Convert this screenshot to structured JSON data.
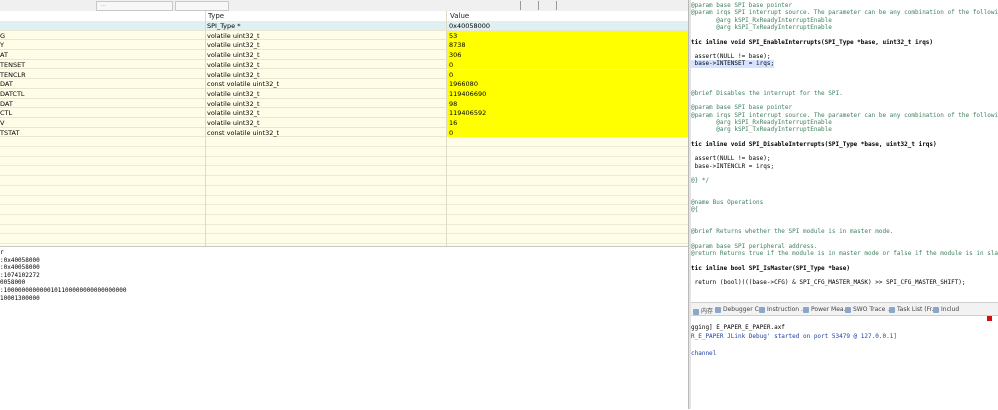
{
  "toolbar": {
    "stub_text": "...",
    "right_text": "497  /**"
  },
  "table": {
    "headers": {
      "name": "",
      "type": "Type",
      "value": "Value"
    },
    "rows": [
      {
        "name": "",
        "type": "SPI_Type *",
        "value": "0x40058000"
      },
      {
        "name": "G",
        "type": "volatile uint32_t",
        "value": "53"
      },
      {
        "name": "Y",
        "type": "volatile uint32_t",
        "value": "8738"
      },
      {
        "name": "AT",
        "type": "volatile uint32_t",
        "value": "306"
      },
      {
        "name": "TENSET",
        "type": "volatile uint32_t",
        "value": "0"
      },
      {
        "name": "TENCLR",
        "type": "volatile uint32_t",
        "value": "0"
      },
      {
        "name": "DAT",
        "type": "const volatile uint32_t",
        "value": "1966080"
      },
      {
        "name": "DATCTL",
        "type": "volatile uint32_t",
        "value": "119406690"
      },
      {
        "name": "DAT",
        "type": "volatile uint32_t",
        "value": "98"
      },
      {
        "name": "CTL",
        "type": "volatile uint32_t",
        "value": "119406592"
      },
      {
        "name": "V",
        "type": "volatile uint32_t",
        "value": "16"
      },
      {
        "name": "TSTAT",
        "type": "const volatile uint32_t",
        "value": "0"
      }
    ]
  },
  "console": {
    "lines": [
      "r",
      ":0x40058000",
      ":0x40058000",
      ":1074102272",
      "0058000",
      ":1000000000000101100000000000000000",
      "10001300000"
    ]
  },
  "editor": {
    "lines": [
      {
        "t": "@param base SPI base pointer",
        "k": "c"
      },
      {
        "t": "@param irqs SPI interrupt source. The parameter can be any combination of the following value",
        "k": "c"
      },
      {
        "t": "       @arg kSPI_RxReadyInterruptEnable",
        "k": "c"
      },
      {
        "t": "       @arg kSPI_TxReadyInterruptEnable",
        "k": "c"
      },
      {
        "t": "",
        "k": ""
      },
      {
        "t": "tic inline void SPI_EnableInterrupts(SPI_Type *base, uint32_t irqs)",
        "k": "f"
      },
      {
        "t": "",
        "k": ""
      },
      {
        "t": " assert(NULL != base);",
        "k": "n"
      },
      {
        "t": " base->INTENSET = irqs;",
        "k": "h"
      },
      {
        "t": "",
        "k": ""
      },
      {
        "t": "",
        "k": ""
      },
      {
        "t": "",
        "k": ""
      },
      {
        "t": "@brief Disables the interrupt for the SPI.",
        "k": "c"
      },
      {
        "t": "",
        "k": ""
      },
      {
        "t": "@param base SPI base pointer",
        "k": "c"
      },
      {
        "t": "@param irqs SPI interrupt source. The parameter can be any combination of the following value",
        "k": "c"
      },
      {
        "t": "       @arg kSPI_RxReadyInterruptEnable",
        "k": "c"
      },
      {
        "t": "       @arg kSPI_TxReadyInterruptEnable",
        "k": "c"
      },
      {
        "t": "",
        "k": ""
      },
      {
        "t": "tic inline void SPI_DisableInterrupts(SPI_Type *base, uint32_t irqs)",
        "k": "f"
      },
      {
        "t": "",
        "k": ""
      },
      {
        "t": " assert(NULL != base);",
        "k": "n"
      },
      {
        "t": " base->INTENCLR = irqs;",
        "k": "n"
      },
      {
        "t": "",
        "k": ""
      },
      {
        "t": "@} */",
        "k": "c"
      },
      {
        "t": "",
        "k": ""
      },
      {
        "t": "",
        "k": ""
      },
      {
        "t": "@name Bus Operations",
        "k": "c"
      },
      {
        "t": "@{",
        "k": "c"
      },
      {
        "t": "",
        "k": ""
      },
      {
        "t": "",
        "k": ""
      },
      {
        "t": "@brief Returns whether the SPI module is in master mode.",
        "k": "c"
      },
      {
        "t": "",
        "k": ""
      },
      {
        "t": "@param base SPI peripheral address.",
        "k": "c"
      },
      {
        "t": "@return Returns true if the module is in master mode or false if the module is in slave mode.",
        "k": "c"
      },
      {
        "t": "",
        "k": ""
      },
      {
        "t": "tic inline bool SPI_IsMaster(SPI_Type *base)",
        "k": "f"
      },
      {
        "t": "",
        "k": ""
      },
      {
        "t": " return (bool)(((base->CFG) & SPI_CFG_MASTER_MASK) >> SPI_CFG_MASTER_SHIFT);",
        "k": "n"
      }
    ]
  },
  "bottom_tabs": [
    {
      "label": "内存",
      "icon": "memory-icon"
    },
    {
      "label": "Debugger C...",
      "icon": "debugger-icon"
    },
    {
      "label": "Instruction ...",
      "icon": "instruction-icon"
    },
    {
      "label": "Power Mea...",
      "icon": "power-icon"
    },
    {
      "label": "SWO Trace ...",
      "icon": "swo-icon"
    },
    {
      "label": "Task List (Fr...",
      "icon": "task-list-icon"
    },
    {
      "label": "Includ",
      "icon": "include-icon"
    }
  ],
  "right_console": {
    "lines": [
      {
        "t": "gging] E_PAPER_E_PAPER.axf",
        "blue": false
      },
      {
        "t": "R_E_PAPER JLink Debug' started on port 53479 @ 127.0.0.1]",
        "blue": true
      },
      {
        "t": "",
        "blue": false
      },
      {
        "t": "channel",
        "blue": true
      }
    ]
  },
  "colors": {
    "value_highlight": "#ffff00",
    "row_bg": "#fffde8",
    "first_row": "#dff0f2"
  }
}
